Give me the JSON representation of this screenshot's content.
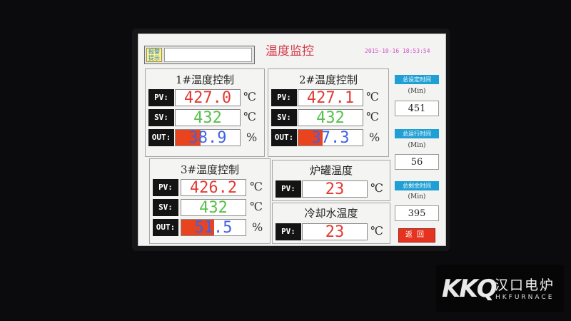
{
  "screen": {
    "title": "温度监控",
    "datetime": "2015-10-16 18:53:54",
    "alarm_label": "报警提示",
    "alarm_text": ""
  },
  "controllers": [
    {
      "title": "1#温度控制",
      "pv": "427.0",
      "sv": "432",
      "out": "38.9",
      "out_percent": 38.9
    },
    {
      "title": "2#温度控制",
      "pv": "427.1",
      "sv": "432",
      "out": "37.3",
      "out_percent": 37.3
    },
    {
      "title": "3#温度控制",
      "pv": "426.2",
      "sv": "432",
      "out": "51.5",
      "out_percent": 51.5
    }
  ],
  "labels": {
    "pv": "PV:",
    "sv": "SV:",
    "out": "OUT:",
    "celsius": "℃",
    "percent": "%"
  },
  "furnace_tank": {
    "title": "炉罐温度",
    "pv": "23"
  },
  "cooling_water": {
    "title": "冷却水温度",
    "pv": "23"
  },
  "side": {
    "total_set_time": {
      "label": "总设定时间",
      "unit": "(Min)",
      "value": "451"
    },
    "total_run_time": {
      "label": "总运行时间",
      "unit": "(Min)",
      "value": "56"
    },
    "total_remaining_time": {
      "label": "总剩余时间",
      "unit": "(Min)",
      "value": "395"
    },
    "back_label": "返回"
  },
  "watermark": {
    "mark": "KKQ",
    "cn": "汉口电炉",
    "en": "HKFURNACE"
  },
  "colors": {
    "pv": "#e23b34",
    "sv": "#55c24a",
    "out": "#3f63e6",
    "out_bar": "#e8441f",
    "side_header": "#1f9fd3",
    "title": "#d43a4a"
  }
}
